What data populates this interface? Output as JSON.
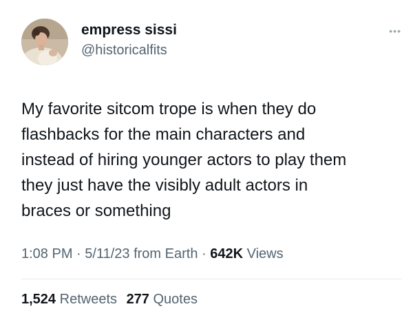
{
  "author": {
    "display_name": "empress sissi",
    "handle": "@historicalfits",
    "avatar_icon": "profile-avatar-portrait"
  },
  "more_icon": "more-options-icon",
  "tweet": {
    "text_lines": [
      "My favorite sitcom trope is when they do",
      "flashbacks for the main characters and",
      "instead of hiring younger actors to play them",
      "they just have the visibly adult actors in",
      "braces or something"
    ],
    "time": "1:08 PM",
    "separator": "·",
    "date": "5/11/23",
    "source": "from Earth",
    "views_count": "642K",
    "views_label": "Views"
  },
  "stats": {
    "retweets_count": "1,524",
    "retweets_label": "Retweets",
    "quotes_count": "277",
    "quotes_label": "Quotes"
  },
  "colors": {
    "text": "#0f1419",
    "secondary": "#536471",
    "divider": "#e6ebef"
  }
}
